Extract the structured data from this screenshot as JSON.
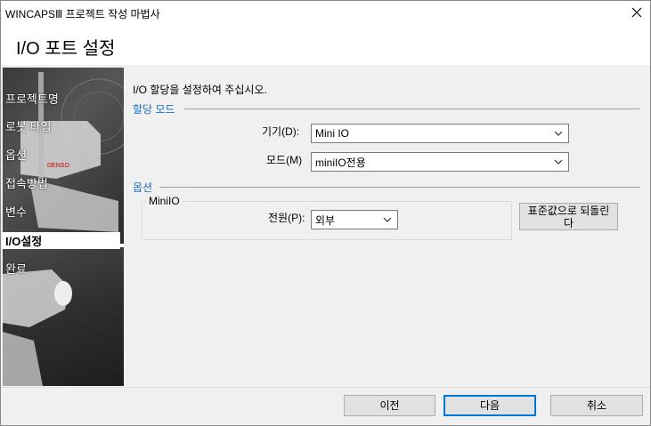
{
  "window": {
    "title": "WINCAPSⅢ 프로젝트 작성 마법사",
    "close_icon": "close-icon"
  },
  "header": {
    "page_title": "I/O 포트 설정"
  },
  "sidebar": {
    "items": [
      {
        "label": "프로젝트명",
        "active": false
      },
      {
        "label": "로봇 타입",
        "active": false
      },
      {
        "label": "옵션",
        "active": false
      },
      {
        "label": "접속방법",
        "active": false
      },
      {
        "label": "변수",
        "active": false
      },
      {
        "label": "I/O설정",
        "active": true
      },
      {
        "label": "완료",
        "active": false
      }
    ]
  },
  "main": {
    "instruction": "I/O 할당을 설정하여 주십시오.",
    "allocation_group": {
      "label": "할당 모드",
      "device": {
        "label": "기기(D):",
        "value": "Mini IO"
      },
      "mode": {
        "label": "모드(M)",
        "value": "miniIO전용"
      }
    },
    "options_group": {
      "label": "옵션",
      "miniio_group": {
        "label": "MiniIO",
        "power": {
          "label": "전원(P):",
          "value": "외부"
        }
      },
      "reset_button": "표준값으로 되돌린다"
    }
  },
  "footer": {
    "back_button": "이전",
    "next_button": "다음",
    "cancel_button": "취소"
  },
  "colors": {
    "accent": "#1f6fc9",
    "focus": "#0078d7",
    "panel_bg": "#f0f0f0"
  }
}
